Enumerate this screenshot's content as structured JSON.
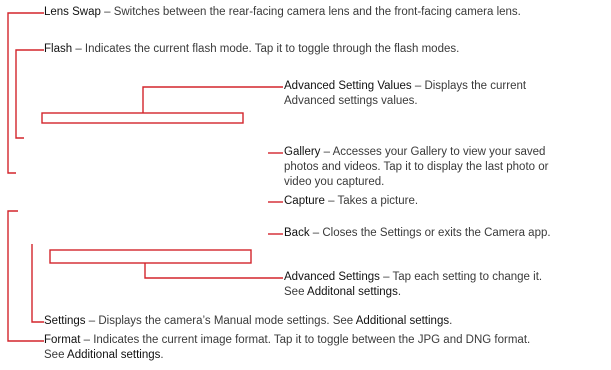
{
  "theme": {
    "accent": "#d3252c",
    "text": "#3a3a3a"
  },
  "annotations": {
    "lens_swap": {
      "term": "Lens Swap",
      "desc": " – Switches between the rear-facing camera lens and the front-facing camera lens."
    },
    "flash": {
      "term": "Flash",
      "desc": " – Indicates the current flash mode. Tap it to toggle through the flash modes."
    },
    "advanced_values": {
      "term": "Advanced Setting Values",
      "desc1": " – Displays the current",
      "line2": "Advanced settings values."
    },
    "gallery": {
      "term": "Gallery",
      "desc1": " – Accesses your Gallery to view your saved",
      "line2": "photos and videos. Tap it to display the last photo or",
      "line3": "video you captured."
    },
    "capture": {
      "term": "Capture",
      "desc": " – Takes a picture."
    },
    "back": {
      "term": "Back",
      "desc": " – Closes the Settings or exits the Camera app."
    },
    "advanced_settings": {
      "term": "Advanced Settings",
      "desc1": " – Tap each setting to change it.",
      "line2_pre": "See ",
      "ref": "Additonal settings",
      "line2_post": "."
    },
    "settings": {
      "term": "Settings",
      "desc": " – Displays the camera’s Manual mode settings. See ",
      "ref": "Additional settings",
      "post": "."
    },
    "format": {
      "term": "Format",
      "desc1": " – Indicates the current image format. Tap it to toggle between the JPG and DNG format.",
      "line2_pre": "See ",
      "ref": "Additional settings",
      "line2_post": "."
    }
  }
}
